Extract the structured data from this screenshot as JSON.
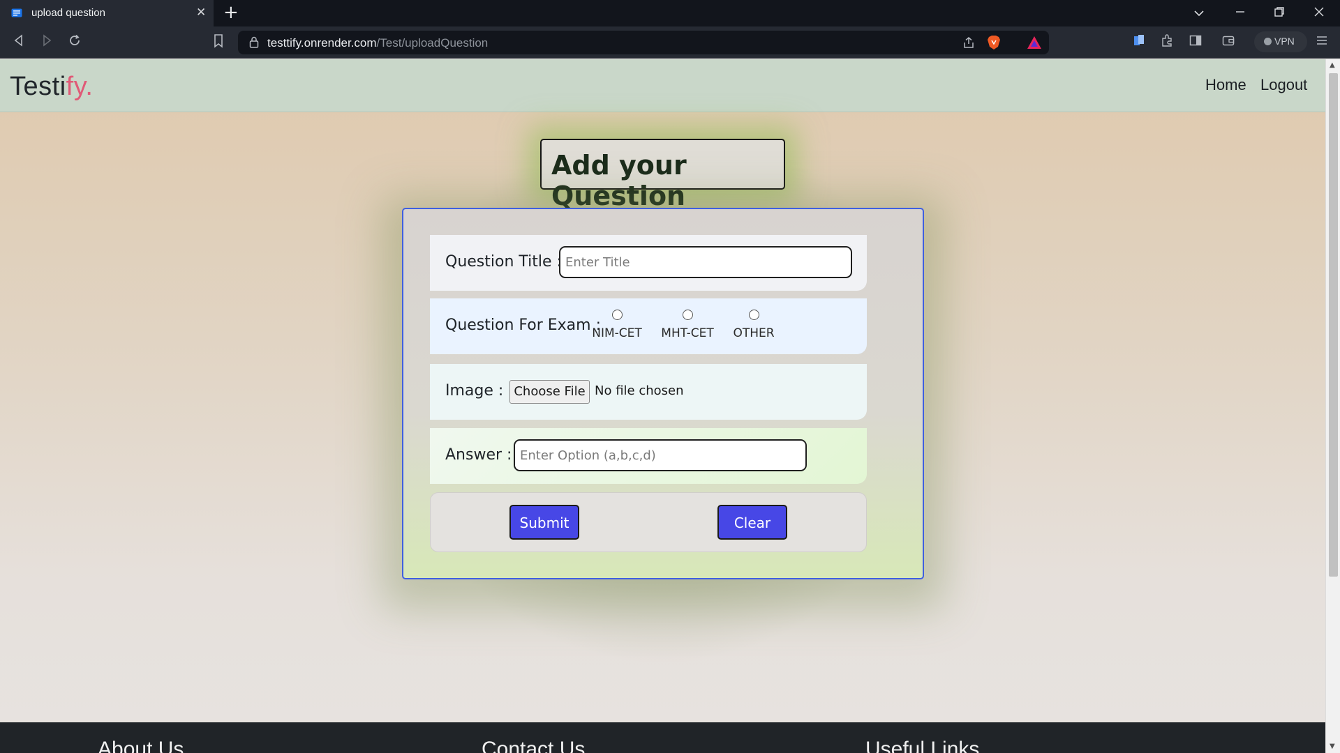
{
  "browser": {
    "tab_title": "upload question",
    "new_tab_symbol": "+",
    "url_host": "testtify.onrender.com",
    "url_path": "/Test/uploadQuestion",
    "vpn_label": "VPN"
  },
  "site": {
    "brand_main": "Testi",
    "brand_accent": "fy.",
    "brand_accent_color": "#e05a77",
    "nav": [
      {
        "label": "Home"
      },
      {
        "label": "Logout"
      }
    ]
  },
  "form": {
    "heading": "Add your Question",
    "title_label": "Question Title :",
    "title_placeholder": "Enter Title",
    "exam_label": "Question For Exam :",
    "exam_options": [
      {
        "label": "NIM-CET"
      },
      {
        "label": "MHT-CET"
      },
      {
        "label": "OTHER"
      }
    ],
    "image_label": "Image :",
    "choose_file_label": "Choose File",
    "file_status": "No file chosen",
    "answer_label": "Answer :",
    "answer_placeholder": "Enter Option (a,b,c,d)",
    "submit_label": "Submit",
    "clear_label": "Clear",
    "button_color": "#4747e6"
  },
  "footer": {
    "headings": [
      "About Us",
      "Contact Us",
      "Useful Links"
    ]
  }
}
